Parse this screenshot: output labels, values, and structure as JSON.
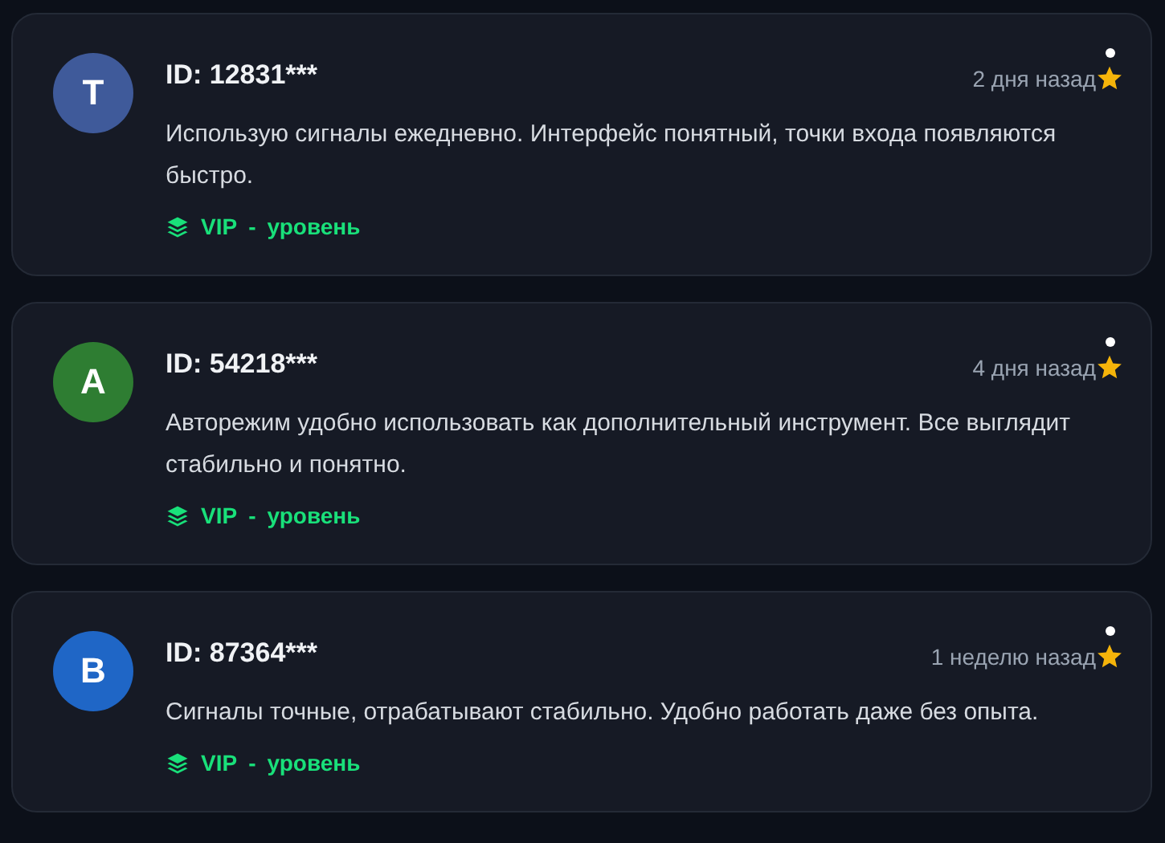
{
  "reviews": [
    {
      "initial": "T",
      "color": "#3f5a9a",
      "user_id": "ID: 12831***",
      "time": "2 дня назад",
      "text": "Использую сигналы ежедневно. Интерфейс понятный, точки входа появляются быстро.",
      "tier": "VIP",
      "separator": "-",
      "tier_suffix": "уровень"
    },
    {
      "initial": "A",
      "color": "#2e7d32",
      "user_id": "ID: 54218***",
      "time": "4 дня назад",
      "text": "Авторежим удобно использовать как дополнительный инструмент. Все выглядит стабильно и понятно.",
      "tier": "VIP",
      "separator": "-",
      "tier_suffix": "уровень"
    },
    {
      "initial": "B",
      "color": "#1f66c6",
      "user_id": "ID: 87364***",
      "time": "1 неделю назад",
      "text": "Сигналы точные, отрабатывают стабильно. Удобно работать даже без опыта.",
      "tier": "VIP",
      "separator": "-",
      "tier_suffix": "уровень"
    }
  ]
}
